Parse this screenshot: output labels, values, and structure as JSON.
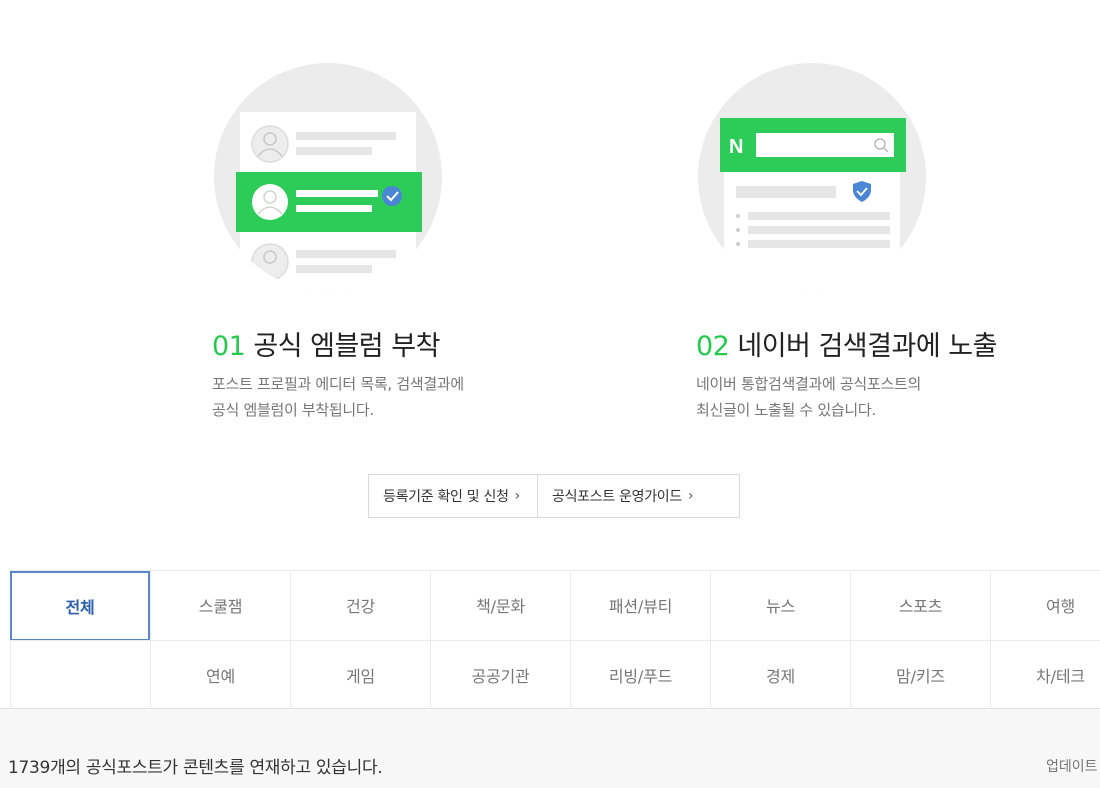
{
  "features": [
    {
      "number": "01",
      "title": "공식 엠블럼 부착",
      "desc_lines": [
        "포스트 프로필과 에디터 목록, 검색결과에",
        "공식 엠블럼이 부착됩니다."
      ],
      "illustration_icon": "profile-list-emblem-illustration"
    },
    {
      "number": "02",
      "title": "네이버 검색결과에 노출",
      "desc_lines": [
        "네이버 통합검색결과에 공식포스트의",
        "최신글이 노출될 수 있습니다."
      ],
      "illustration_icon": "naver-search-result-illustration",
      "naver_logo_text": "N"
    }
  ],
  "links": [
    {
      "label": "등록기준 확인 및 신청",
      "chevron": "›"
    },
    {
      "label": "공식포스트 운영가이드",
      "chevron": "›"
    }
  ],
  "categories": {
    "row1": [
      "전체",
      "스쿨잼",
      "건강",
      "책/문화",
      "패션/뷰티",
      "뉴스",
      "스포츠",
      "여행"
    ],
    "row2": [
      "",
      "연예",
      "게임",
      "공공기관",
      "리빙/푸드",
      "경제",
      "맘/키즈",
      "차/테크"
    ],
    "active": "전체"
  },
  "status": {
    "text": "1739개의 공식포스트가 콘텐츠를 연재하고 있습니다.",
    "update_label": "업데이트"
  },
  "colors": {
    "accent_green": "#27c84f",
    "active_border": "#5a88c7",
    "emblem_blue": "#4a86d4"
  }
}
